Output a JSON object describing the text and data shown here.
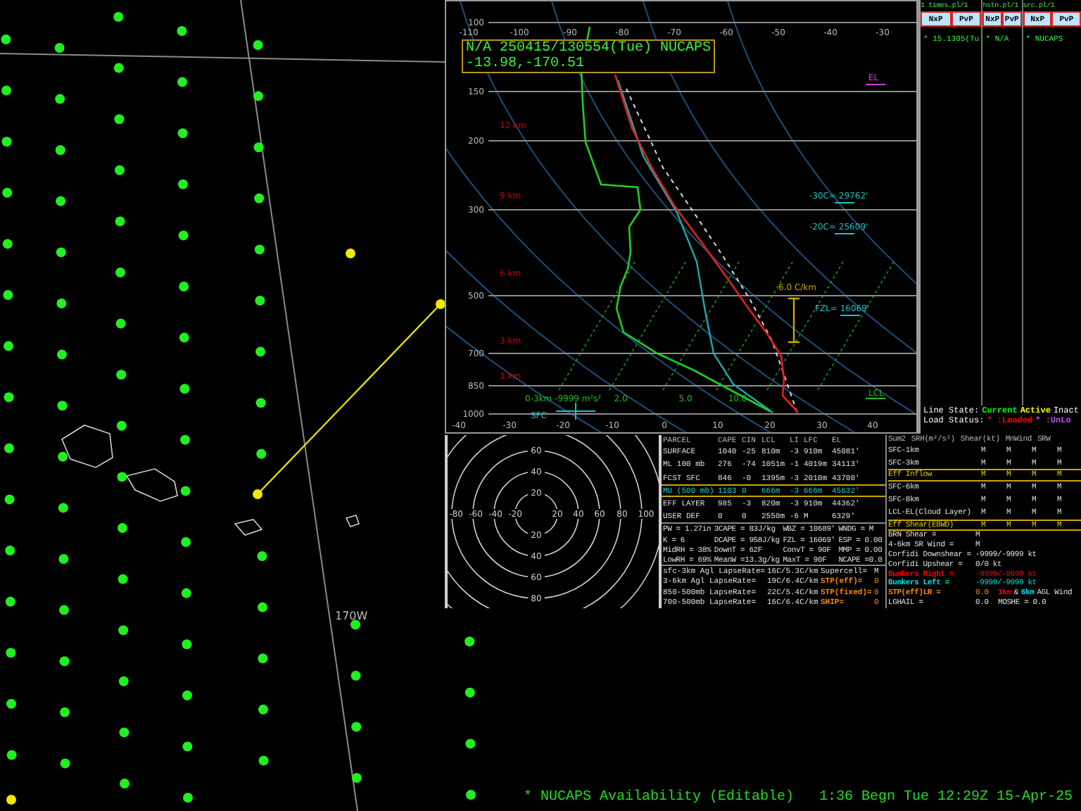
{
  "map": {
    "meridian_label": "170W"
  },
  "sounding": {
    "header": [
      "N/A 250415/130554(Tue) NUCAPS",
      "-13.98,-170.51"
    ],
    "pressure_labels": [
      "100",
      "150",
      "200",
      "300",
      "500",
      "700",
      "850",
      "1000"
    ],
    "top_temperature_labels": [
      "-110",
      "-100",
      "-90",
      "-80",
      "-70",
      "-60",
      "-50",
      "-40",
      "-30"
    ],
    "bottom_temperature_labels": [
      "-40",
      "-30",
      "-20",
      "-10",
      "0",
      "10",
      "20",
      "30",
      "40"
    ],
    "height_labels": [
      "12 km",
      "9 km",
      "6 km",
      "3 km",
      "1 km"
    ],
    "mixing_ratio_labels": [
      "2.0",
      "5.0",
      "10.0"
    ],
    "el_label": "EL",
    "isotherm_heights": [
      "-30C= 29762'",
      "-20C= 25609'"
    ],
    "freezing_level": "FZL= 16069'",
    "lapse_rate": "6.0 C/km",
    "lcl_label": "LCL",
    "helicity_label": "0-3km -9999 m²s²",
    "surface_label": "SFC"
  },
  "product_panel": {
    "columns": [
      {
        "title": "1 times.pl/1",
        "buttons": [
          "NxP",
          "PvP"
        ],
        "entry": "* 15.1305(Tu"
      },
      {
        "title": "hstn.pl/1",
        "buttons": [
          "NxP",
          "PvP"
        ],
        "entry": "* N/A"
      },
      {
        "title": "src.pl/1",
        "buttons": [
          "NxP",
          "PvP"
        ],
        "entry": "* NUCAPS"
      }
    ],
    "legend_lines": [
      [
        {
          "text": "Line State:"
        },
        {
          "text": "Current",
          "color": "#00ff00"
        },
        {
          "text": "Active",
          "color": "#ffff00"
        },
        {
          "text": "Inact"
        }
      ],
      [
        {
          "text": "Load Status:"
        },
        {
          "text": "* :Loaded",
          "color": "#ff0000"
        },
        {
          "text": "* :UnLo",
          "color": "#c050ff"
        }
      ]
    ]
  },
  "hodograph": {
    "vertical_labels": [
      "60",
      "40",
      "20",
      "20",
      "40",
      "60",
      "80"
    ],
    "horizontal_labels": [
      "-80",
      "-60",
      "-40",
      "-20",
      "20",
      "40",
      "60",
      "80",
      "100"
    ]
  },
  "parcel_table": {
    "columns": [
      "PARCEL",
      "CAPE",
      "CIN",
      "LCL",
      "LI",
      "LFC",
      "EL"
    ],
    "rows": [
      {
        "cells": [
          "SURFACE",
          "1040",
          "-25",
          "810m",
          "-3",
          "910m",
          "45081'"
        ],
        "highlighted": false
      },
      {
        "cells": [
          "ML 100 mb",
          "276",
          "-74",
          "1051m",
          "-1",
          "4019m",
          "34113'"
        ],
        "highlighted": false
      },
      {
        "cells": [
          "FCST SFC",
          "846",
          "-0",
          "1395m",
          "-3",
          "2010m",
          "43700'"
        ],
        "highlighted": false
      },
      {
        "cells": [
          "MU (500 mb)",
          "1103",
          "0",
          "666m",
          "-3",
          "666m",
          "45632'"
        ],
        "highlighted": true
      },
      {
        "cells": [
          "EFF LAYER",
          "985",
          "-3",
          "820m",
          "-3",
          "910m",
          "44362'"
        ],
        "highlighted": false
      },
      {
        "cells": [
          "USER DEF",
          "0",
          "0",
          "2550m",
          "-6",
          "M",
          "6329'"
        ],
        "highlighted": false
      }
    ]
  },
  "indices": [
    [
      "PW = 1.27in",
      "3CAPE = 83J/kg",
      "WBZ = 10689'",
      "WNDG = M"
    ],
    [
      "K = 6",
      "DCAPE = 958J/kg",
      "FZL = 16069'",
      "ESP = 0.00"
    ],
    [
      "MidRH = 38%",
      "DownT = 62F",
      "ConvT = 90F",
      "MMP = 0.00"
    ],
    [
      "LowRH = 69%",
      "MeanW =13.3g/kg",
      "MaxT = 90F",
      "NCAPE =0.0"
    ]
  ],
  "lapse_rates": [
    {
      "label": "sfc-3km Agl LapseRate=",
      "value": "16C/5.3C/km",
      "param": "Supercell=",
      "param_value": "M"
    },
    {
      "label": "3-6km Agl LapseRate=",
      "value": "19C/6.4C/km",
      "param": "STP(eff)=",
      "param_value": "0",
      "color": "#ff8c00"
    },
    {
      "label": "850-500mb LapseRate=",
      "value": "22C/5.4C/km",
      "param": "STP(fixed)=",
      "param_value": "0",
      "color": "#ff8c00"
    },
    {
      "label": "700-500mb LapseRate=",
      "value": "16C/6.4C/km",
      "param": "SHIP=",
      "param_value": "0",
      "color": "#ff8c00"
    }
  ],
  "kinematics": {
    "columns": [
      "Sum2",
      "SRH(m²/s²)",
      "Shear(kt)",
      "MnWind",
      "SRW"
    ],
    "rows": [
      {
        "label": "SFC-1km",
        "values": [
          "M",
          "M",
          "M",
          "M"
        ],
        "highlighted": false
      },
      {
        "label": "SFC-3km",
        "values": [
          "M",
          "M",
          "M",
          "M"
        ],
        "highlighted": false
      },
      {
        "label": "Eff Inflow",
        "values": [
          "M",
          "M",
          "M",
          "M"
        ],
        "highlighted": true
      },
      {
        "label": "SFC-6km",
        "values": [
          "M",
          "M",
          "M",
          "M"
        ],
        "highlighted": false
      },
      {
        "label": "SFC-8km",
        "values": [
          "M",
          "M",
          "M",
          "M"
        ],
        "highlighted": false
      },
      {
        "label": "LCL-EL(Cloud Layer)",
        "values": [
          "M",
          "M",
          "M",
          "M"
        ],
        "highlighted": false
      },
      {
        "label": "Eff Shear(EBWD)",
        "values": [
          "M",
          "M",
          "M",
          "M"
        ],
        "highlighted": true
      }
    ],
    "extra_rows": [
      {
        "label": "BRN Shear =",
        "value": "M"
      },
      {
        "label": "4-6km SR Wind =",
        "value": "M"
      },
      {
        "label": "Corfidi Downshear =",
        "value": "-9999/-9999 kt"
      },
      {
        "label": "Corfidi Upshear =",
        "value": "0/0 kt"
      },
      {
        "label": "Bunkers Right =",
        "value": "-9999/-9999 kt",
        "color": "#ff0000"
      },
      {
        "label": "Bunkers Left =",
        "value": "-9999/-9999 kt",
        "color": "#00e0e0"
      },
      {
        "label": "STP(eff)LR =",
        "value": "0.0",
        "color": "#ff8c00",
        "note": [
          {
            "text": "1km",
            "color": "#ff0000"
          },
          {
            "text": "&"
          },
          {
            "text": "6km",
            "color": "#00e0e0"
          },
          {
            "text": "AGL Wind"
          }
        ]
      },
      {
        "label": "LGHAIL =",
        "value": "0.0",
        "note": [
          {
            "text": "MOSHE = 0.0"
          }
        ]
      }
    ]
  },
  "status_bar": [
    "* NUCAPS Availability (Editable)",
    "1:36 Begn Tue 12:29Z 15-Apr-25"
  ]
}
